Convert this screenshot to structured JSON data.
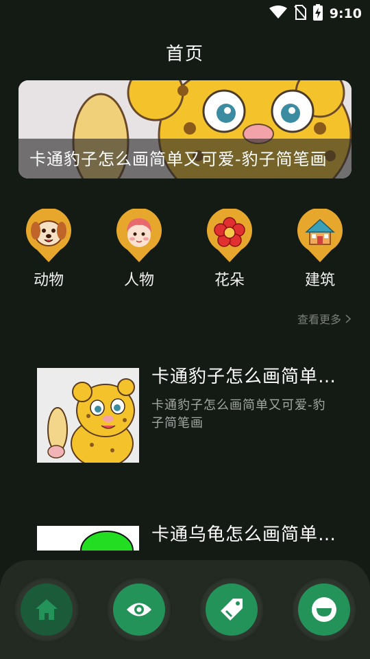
{
  "status_bar": {
    "time": "9:10",
    "icons": [
      "wifi-icon",
      "no-sim-icon",
      "battery-charging-icon"
    ]
  },
  "header": {
    "title": "首页"
  },
  "banner": {
    "caption": "卡通豹子怎么画简单又可爱-豹子简笔画",
    "image": "cartoon-leopard-image"
  },
  "categories": [
    {
      "label": "动物",
      "icon": "dog-icon"
    },
    {
      "label": "人物",
      "icon": "girl-icon"
    },
    {
      "label": "花朵",
      "icon": "flower-icon"
    },
    {
      "label": "建筑",
      "icon": "house-icon"
    }
  ],
  "see_more": {
    "label": "查看更多"
  },
  "list": [
    {
      "title": "卡通豹子怎么画简单又可爱-豹子简笔画",
      "desc": "卡通豹子怎么画简单又可爱-豹子简笔画",
      "image": "cartoon-leopard-image"
    },
    {
      "title": "卡通乌龟怎么画简单又可爱",
      "desc": "",
      "image": "cartoon-turtle-image"
    }
  ],
  "bottom_nav": [
    {
      "icon": "home-icon",
      "active": true
    },
    {
      "icon": "eye-icon",
      "active": false
    },
    {
      "icon": "tag-icon",
      "active": false
    },
    {
      "icon": "smile-icon",
      "active": false
    }
  ],
  "colors": {
    "background": "#141b14",
    "accent_green": "#23935a",
    "category_yellow": "#e6a72c",
    "nav_bar": "#232a22"
  }
}
